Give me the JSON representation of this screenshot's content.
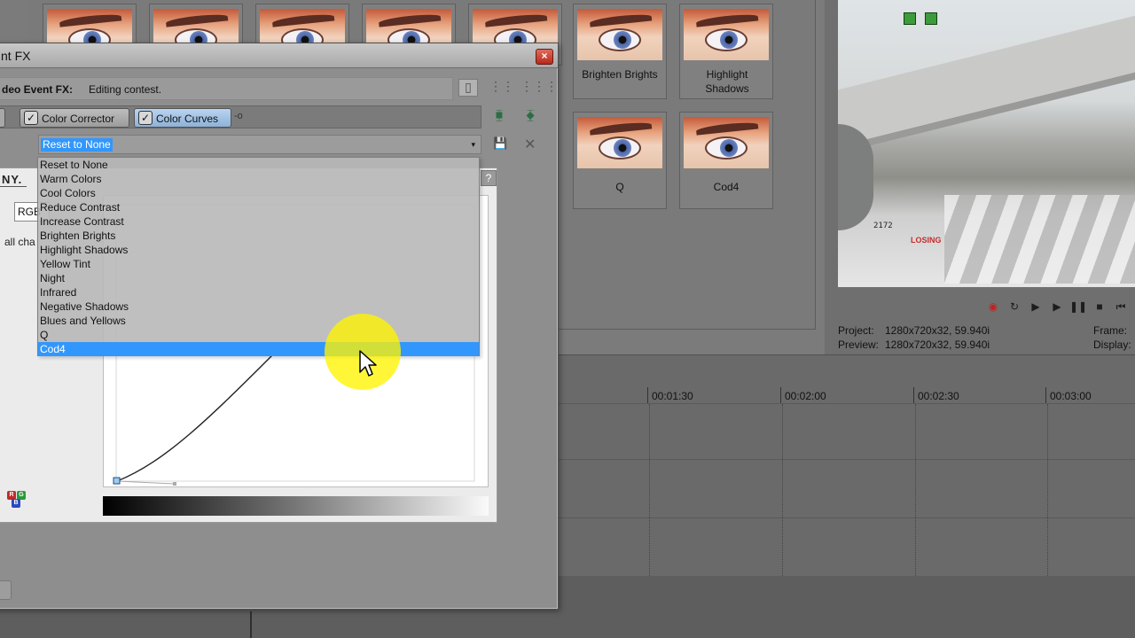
{
  "fx_thumbnails": [
    {
      "label": ""
    },
    {
      "label": ""
    },
    {
      "label": ""
    },
    {
      "label": ""
    },
    {
      "label": ""
    },
    {
      "label": "Brighten Brights"
    },
    {
      "label": "Highlight Shadows"
    },
    {
      "label": "Q"
    },
    {
      "label": "Cod4"
    }
  ],
  "dialog": {
    "title": "nt FX",
    "close_label": "×",
    "header_label": "deo Event FX:",
    "header_value": "Editing contest.",
    "chain": {
      "color_corrector": "Color Corrector",
      "color_curves": "Color Curves",
      "link_glyph": "-o"
    },
    "preset": {
      "selected": "Reset to None",
      "arrow": "▾"
    },
    "plugin": {
      "brand": "NY.",
      "help": "?",
      "channel": "RGB",
      "apply_text": "all cha"
    }
  },
  "dropdown": {
    "options": [
      "Reset to None",
      "Warm Colors",
      "Cool Colors",
      "Reduce Contrast",
      "Increase Contrast",
      "Brighten Brights",
      "Highlight Shadows",
      "Yellow Tint",
      "Night",
      "Infrared",
      "Negative Shadows",
      "Blues and Yellows",
      "Q",
      "Cod4"
    ],
    "highlighted_index": 13
  },
  "preview": {
    "hud_score": "2172",
    "hud_text": "LOSING",
    "project_label": "Project:",
    "project_value": "1280x720x32, 59.940i",
    "preview_label": "Preview:",
    "preview_value": "1280x720x32, 59.940i",
    "frame_label": "Frame:",
    "display_label": "Display:"
  },
  "timeline": {
    "ticks": [
      "00:01:30",
      "00:02:00",
      "00:02:30",
      "00:03:00"
    ]
  },
  "colors": {
    "selection": "#3297fd",
    "cursor_highlight": "#fff400",
    "record": "#c52020"
  },
  "icons": {
    "transport": [
      "record-icon",
      "loop-icon",
      "play-from-start-icon",
      "play-icon",
      "pause-icon",
      "stop-icon",
      "go-to-start-icon"
    ]
  }
}
